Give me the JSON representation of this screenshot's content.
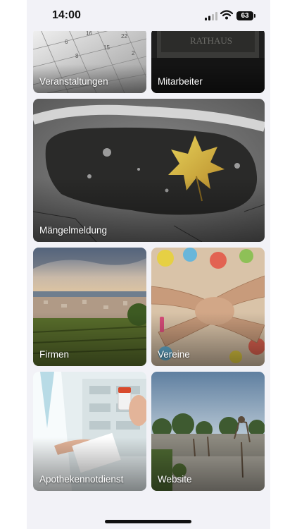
{
  "status_bar": {
    "time": "14:00",
    "battery": "63"
  },
  "tiles": [
    {
      "label": "Veranstaltungen"
    },
    {
      "label": "Mitarbeiter"
    },
    {
      "label": "Mängelmeldung"
    },
    {
      "label": "Firmen"
    },
    {
      "label": "Vereine"
    },
    {
      "label": "Apothekennotdienst"
    },
    {
      "label": "Website"
    }
  ],
  "icons": [
    "signal-icon",
    "wifi-icon",
    "battery-icon"
  ]
}
